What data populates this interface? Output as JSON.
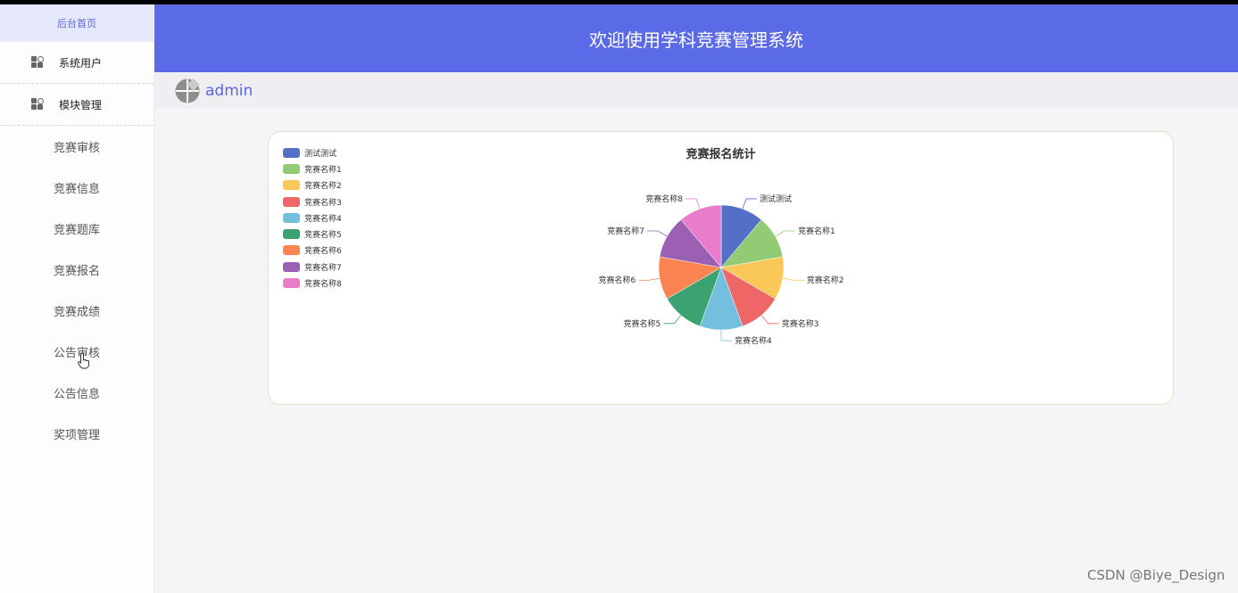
{
  "sidebar": {
    "home": "后台首页",
    "groups": [
      {
        "label": "系统用户",
        "icon": "apps-icon"
      },
      {
        "label": "模块管理",
        "icon": "apps-icon"
      }
    ],
    "items": [
      "竞赛审核",
      "竞赛信息",
      "竞赛题库",
      "竞赛报名",
      "竞赛成绩",
      "公告审核",
      "公告信息",
      "奖项管理"
    ]
  },
  "header": {
    "title": "欢迎使用学科竞赛管理系统"
  },
  "user": {
    "name": "admin",
    "avatar_icon": "avatar-icon"
  },
  "watermark": "CSDN @Biye_Design",
  "chart_data": {
    "type": "pie",
    "title": "竞赛报名统计",
    "legend_position": "top-left",
    "categories": [
      "测试测试",
      "竞赛名称1",
      "竞赛名称2",
      "竞赛名称3",
      "竞赛名称4",
      "竞赛名称5",
      "竞赛名称6",
      "竞赛名称7",
      "竞赛名称8"
    ],
    "values": [
      1,
      1,
      1,
      1,
      1,
      1,
      1,
      1,
      1
    ],
    "colors": [
      "#5470c6",
      "#91cc75",
      "#fac858",
      "#ee6666",
      "#73c0de",
      "#3ba272",
      "#fc8452",
      "#9a60b4",
      "#ea7ccc"
    ]
  }
}
